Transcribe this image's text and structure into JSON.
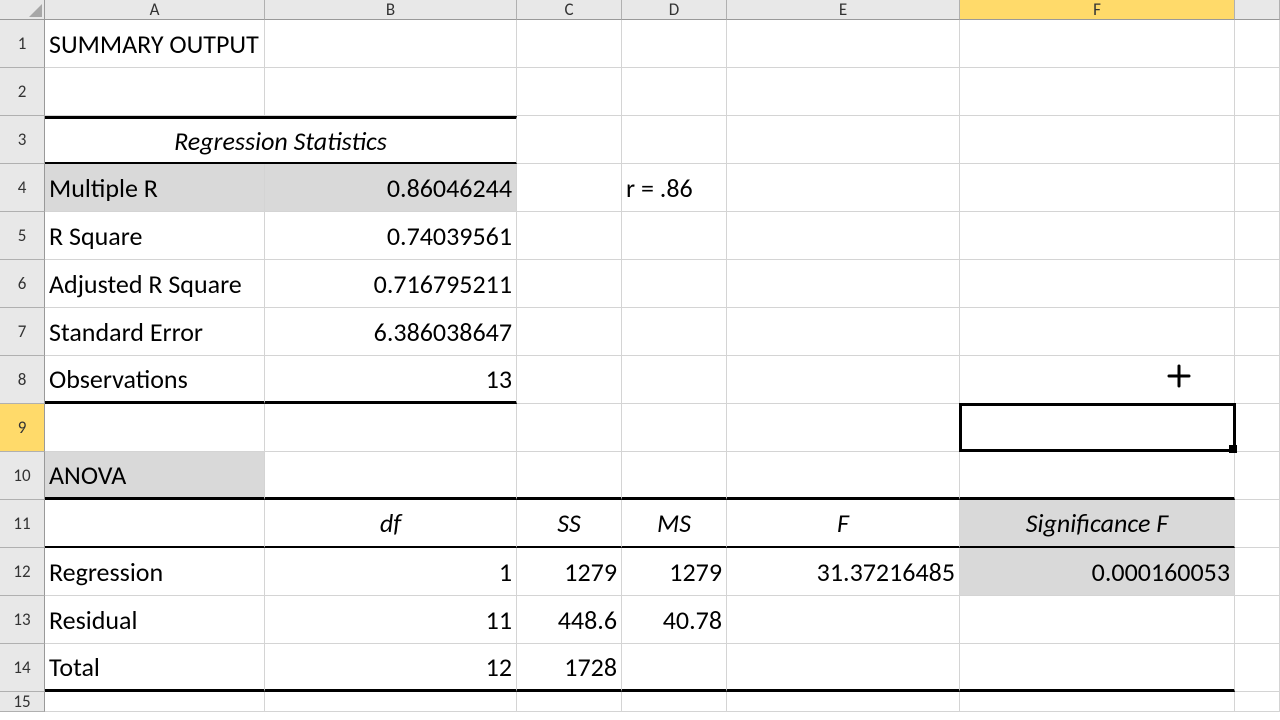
{
  "columns": [
    "A",
    "B",
    "C",
    "D",
    "E",
    "F",
    ""
  ],
  "rows": [
    "1",
    "2",
    "3",
    "4",
    "5",
    "6",
    "7",
    "8",
    "9",
    "10",
    "11",
    "12",
    "13",
    "14",
    "15"
  ],
  "selectedCol": 6,
  "selectedRow": 9,
  "cells": {
    "A1": "SUMMARY OUTPUT",
    "A3": "Regression Statistics",
    "A4": "Multiple R",
    "B4": "0.86046244",
    "D4": "r = .86",
    "A5": "R Square",
    "B5": "0.74039561",
    "A6": "Adjusted R Square",
    "B6": "0.716795211",
    "A7": "Standard Error",
    "B7": "6.386038647",
    "A8": "Observations",
    "B8": "13",
    "A10": "ANOVA",
    "B11": "df",
    "C11": "SS",
    "D11": "MS",
    "E11": "F",
    "F11": "Significance F",
    "A12": "Regression",
    "B12": "1",
    "C12": "1279",
    "D12": "1279",
    "E12": "31.37216485",
    "F12": "0.000160053",
    "A13": "Residual",
    "B13": "11",
    "C13": "448.6",
    "D13": "40.78",
    "A14": "Total",
    "B14": "12",
    "C14": "1728"
  }
}
